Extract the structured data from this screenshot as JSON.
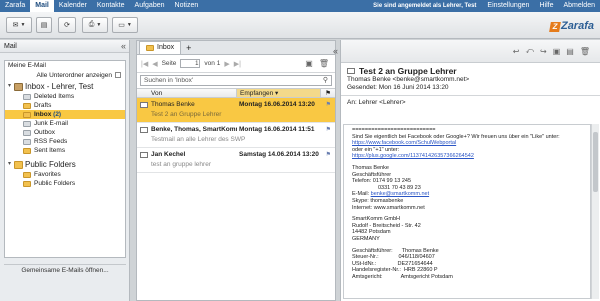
{
  "topnav": {
    "items": [
      "Zarafa",
      "Mail",
      "Kalender",
      "Kontakte",
      "Aufgaben",
      "Notizen"
    ],
    "logged_in": "Sie sind angemeldet als Lehrer, Test",
    "settings": "Einstellungen",
    "help": "Hilfe",
    "logout": "Abmelden"
  },
  "brand": {
    "logo": "Zarafa"
  },
  "leftpanel": {
    "header": "Mail",
    "my_email": "Meine E-Mail",
    "show_all": "Alle Unterordner anzeigen",
    "inbox_root": "Inbox - Lehrer, Test",
    "folders": [
      {
        "label": "Deleted Items",
        "icon": "grey"
      },
      {
        "label": "Drafts",
        "icon": "yellow"
      },
      {
        "label": "Inbox",
        "count": "(2)",
        "icon": "yellow"
      },
      {
        "label": "Junk E-mail",
        "icon": "grey"
      },
      {
        "label": "Outbox",
        "icon": "grey"
      },
      {
        "label": "RSS Feeds",
        "icon": "grey"
      },
      {
        "label": "Sent Items",
        "icon": "yellow"
      }
    ],
    "public_root": "Public Folders",
    "public_folders": [
      "Favorites",
      "Public Folders"
    ],
    "open_shared": "Gemeinsame E-Mails öffnen..."
  },
  "midpanel": {
    "tab": "Inbox",
    "pager": {
      "page_label": "Seite",
      "page": "1",
      "of_label": "von 1"
    },
    "search_placeholder": "Suchen in 'Inbox'",
    "col_from": "Von",
    "col_received": "Empfangen ▾",
    "messages": [
      {
        "from": "Thomas Benke",
        "date": "Montag 16.06.2014 13:20",
        "preview": "Test 2 an Gruppe Lehrer",
        "selected": true
      },
      {
        "from": "Benke, Thomas, SmartKomm...",
        "date": "Montag 16.06.2014 11:51",
        "preview": "Testmail an alle Lehrer des SWP",
        "selected": false
      },
      {
        "from": "Jan Kechel",
        "date": "Samstag 14.06.2014 13:20",
        "preview": "test an gruppe lehrer",
        "selected": false
      }
    ]
  },
  "reading": {
    "subject": "Test 2 an Gruppe Lehrer",
    "from": "Thomas Benke <benke@smartkomm.net>",
    "sent": "Gesendet:  Mon 16 Juni 2014 13:20",
    "to": "An:  Lehrer <Lehrer>",
    "body": {
      "separator": "==========================",
      "l1": "Sind Sie eigentlich bei Facebook oder Google+? Wir freuen uns über ein \"Like\" unter:",
      "link1": "https://www.facebook.com/SchulWebportal",
      "l2": "oder ein \"+1\" unter:",
      "link2": "https://plus.google.com/113741426357366264542",
      "sig1": "Thomas Benke",
      "sig2": "Geschäftsführer",
      "sig3": "Telefon:   0174 99 13 245",
      "sig4": "                 0331 70 43 89 23",
      "sig5_label": "E-Mail:   ",
      "sig5_link": "benke@smartkomm.net",
      "sig6": "Skype:    thomasbenke",
      "sig7": "Internet: www.smartkomm.net",
      "co1": "SmartKomm GmbH",
      "co2": "Rudolf - Breitscheid - Str. 42",
      "co3": "14482 Potsdam",
      "co4": "GERMANY",
      "r1": "Geschäftsführer:      Thomas Benke",
      "r2": "Steuer-Nr.:             046/118/04607",
      "r3": "USt-IdNr.:              DE271654644",
      "r4": "Handelsregister-Nr.:  HRB 22860 P",
      "r5": "Amtsgericht:            Amtsgericht Potsdam"
    }
  }
}
